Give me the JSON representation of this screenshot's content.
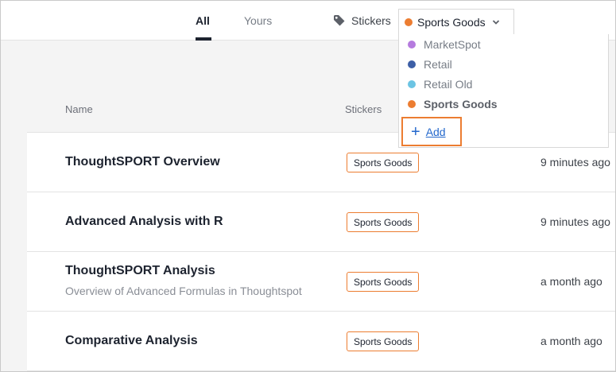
{
  "tabs": [
    {
      "label": "All",
      "active": true
    },
    {
      "label": "Yours",
      "active": false
    }
  ],
  "filter": {
    "label": "Stickers",
    "selected": "Sports Goods",
    "selected_color": "#ec7d31",
    "options": [
      {
        "label": "MarketSpot",
        "color": "#b57bde",
        "selected": false
      },
      {
        "label": "Retail",
        "color": "#3d5fa6",
        "selected": false
      },
      {
        "label": "Retail Old",
        "color": "#6cc4e3",
        "selected": false
      },
      {
        "label": "Sports Goods",
        "color": "#ec7d31",
        "selected": true
      }
    ],
    "add_label": "Add"
  },
  "columns": {
    "name": "Name",
    "stickers": "Stickers"
  },
  "rows": [
    {
      "title": "ThoughtSPORT Overview",
      "subtitle": "",
      "sticker": "Sports Goods",
      "time": "9 minutes ago"
    },
    {
      "title": "Advanced Analysis with R",
      "subtitle": "",
      "sticker": "Sports Goods",
      "time": "9 minutes ago"
    },
    {
      "title": "ThoughtSPORT Analysis",
      "subtitle": "Overview of Advanced Formulas in Thoughtspot",
      "sticker": "Sports Goods",
      "time": "a month ago"
    },
    {
      "title": "Comparative Analysis",
      "subtitle": "",
      "sticker": "Sports Goods",
      "time": "a month ago"
    }
  ],
  "icons": {
    "stickers": "tag-icon",
    "dropdown": "chevron-down-icon",
    "add": "plus-icon"
  }
}
